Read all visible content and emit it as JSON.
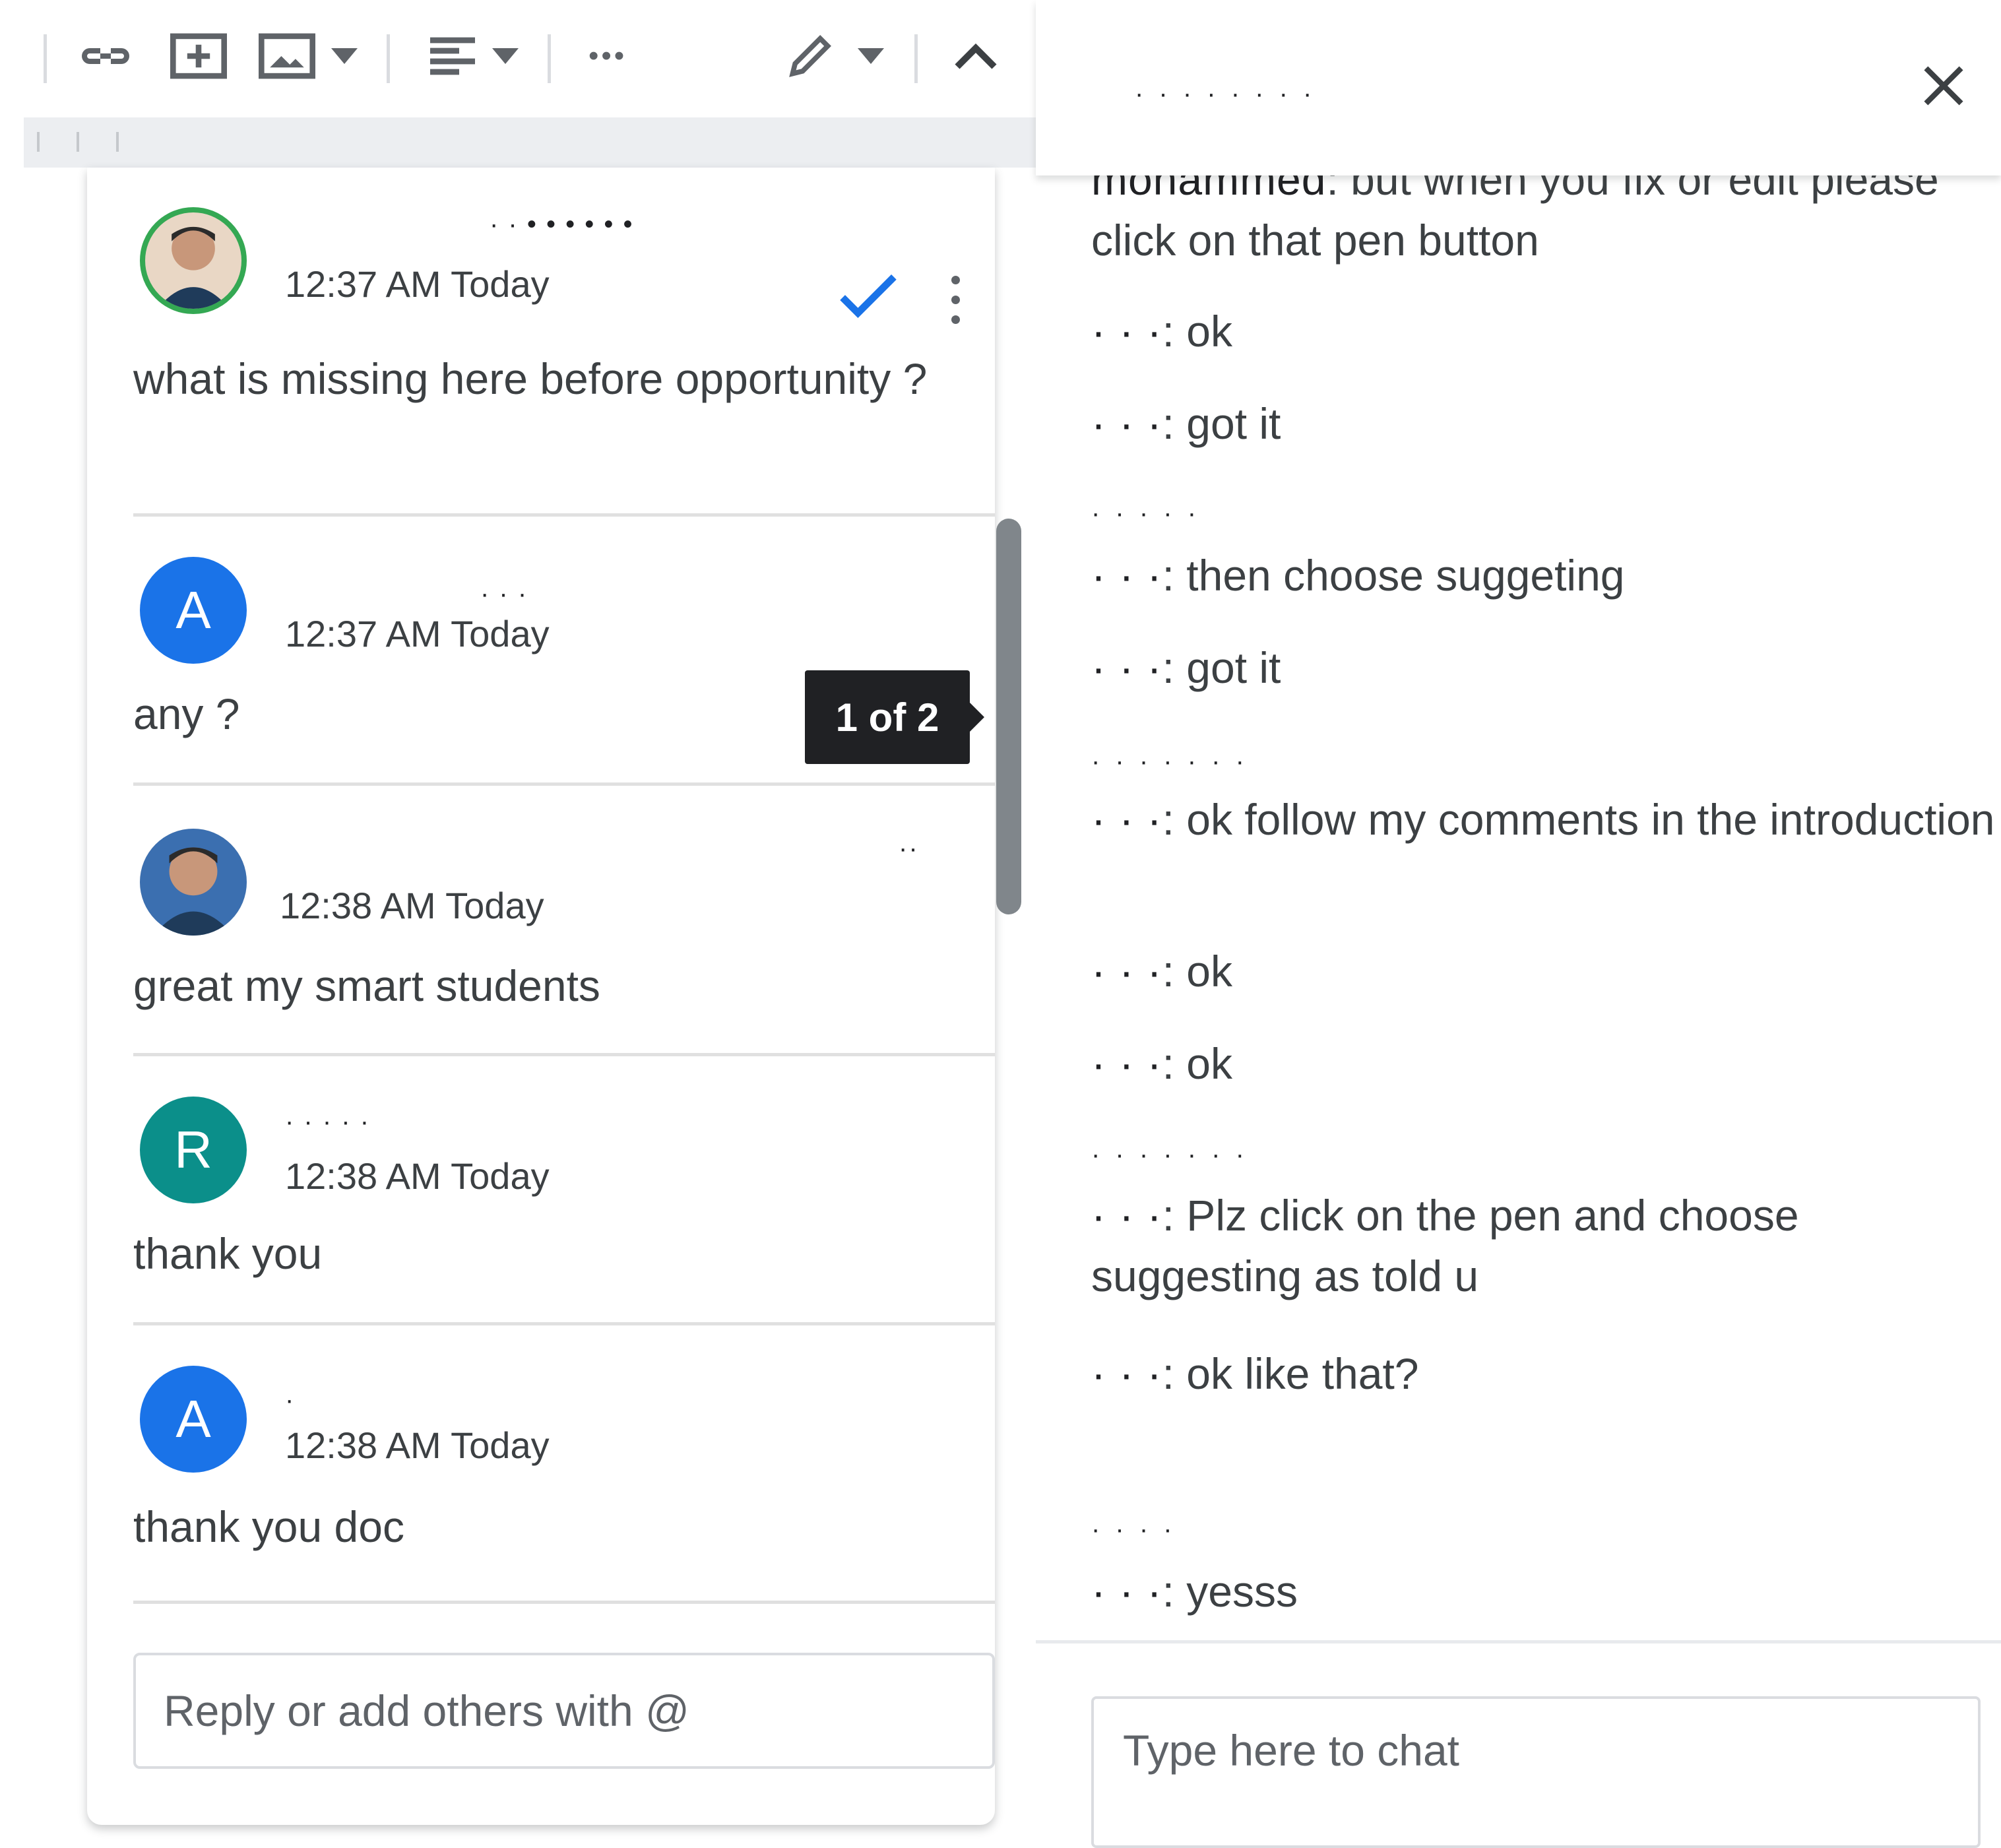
{
  "toolbar": {
    "icons": [
      "link-icon",
      "insert-comment-icon",
      "insert-image-icon",
      "dropdown-icon",
      "align-icon",
      "more-horiz-icon",
      "edit-pencil-icon",
      "collapse-icon"
    ],
    "ellipsis": "•••"
  },
  "comments": {
    "items": [
      {
        "author": "· · • • • • • •",
        "time": "12:37 AM Today",
        "text": "what is missing here before opportunity ?",
        "avatar": "photo"
      },
      {
        "author": "· · ·",
        "time": "12:37 AM Today",
        "text": "any ?",
        "avatar_letter": "A"
      },
      {
        "author": "··",
        "time": "12:38 AM Today",
        "text": "great my smart students",
        "avatar": "photo"
      },
      {
        "author": "· · · · ·",
        "time": "12:38 AM Today",
        "text": "thank you",
        "avatar_letter": "R"
      },
      {
        "author": "·",
        "time": "12:38 AM Today",
        "text": "thank you doc",
        "avatar_letter": "A"
      }
    ],
    "tooltip": "1 of 2",
    "reply_placeholder": "Reply or add others with @",
    "colors": {
      "avatar_blue": "#1a73e8",
      "avatar_teal": "#0b8f8a",
      "resolve": "#1a73e8",
      "avatar_ring": "#34a853"
    }
  },
  "chat": {
    "title": "· · · · · · · ·",
    "messages": [
      {
        "sender": "mohammed",
        "text": "but when you fix  or  edit please  click on that  pen  button"
      },
      {
        "sender": "· · ·",
        "text": "ok"
      },
      {
        "sender": "· · ·",
        "text": "got it"
      },
      {
        "sender": "· · ·",
        "text": "then choose suggeting"
      },
      {
        "sender": "· · ·",
        "text": "got it"
      },
      {
        "sender": "· · ·",
        "text": "ok follow  my comments in the introduction"
      },
      {
        "sender": "· · ·",
        "text": "ok"
      },
      {
        "sender": "· · ·",
        "text": "ok"
      },
      {
        "sender": "· · ·",
        "text": "Plz click on the pen and choose suggesting as told u"
      },
      {
        "sender": "· · ·",
        "text": "ok like that?"
      },
      {
        "sender": "· · ·",
        "text": "yesss"
      }
    ],
    "sender_lines": [
      "· · · · ·",
      "· · · · · · ·",
      "· · · · · · ·",
      "· · · ·"
    ],
    "input_placeholder": "Type here to chat"
  }
}
